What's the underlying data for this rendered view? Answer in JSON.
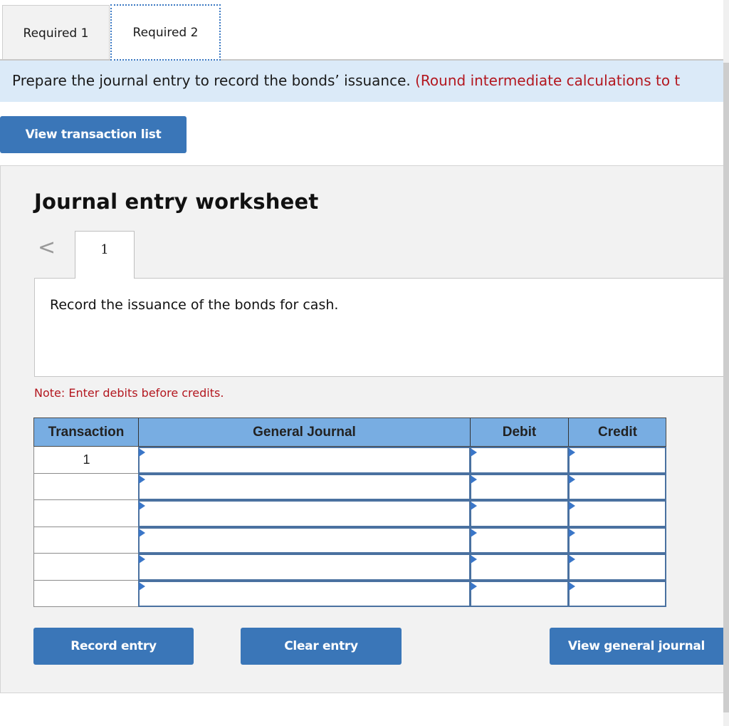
{
  "tabs": [
    {
      "label": "Required 1",
      "active": false
    },
    {
      "label": "Required 2",
      "active": true
    }
  ],
  "instruction": {
    "text": "Prepare the journal entry to record the bonds’ issuance.",
    "note": "(Round intermediate calculations to t"
  },
  "buttons": {
    "view_transaction_list": "View transaction list",
    "record_entry": "Record entry",
    "clear_entry": "Clear entry",
    "view_general_journal": "View general journal"
  },
  "worksheet": {
    "title": "Journal entry worksheet",
    "prev_icon": "chevron-left-icon",
    "prev_glyph": "<",
    "current_step": "1",
    "description": "Record the issuance of the bonds for cash.",
    "note": "Note: Enter debits before credits."
  },
  "journal_table": {
    "headers": {
      "transaction": "Transaction",
      "general_journal": "General Journal",
      "debit": "Debit",
      "credit": "Credit"
    },
    "rows": [
      {
        "transaction": "1",
        "account": "",
        "debit": "",
        "credit": ""
      },
      {
        "transaction": "",
        "account": "",
        "debit": "",
        "credit": ""
      },
      {
        "transaction": "",
        "account": "",
        "debit": "",
        "credit": ""
      },
      {
        "transaction": "",
        "account": "",
        "debit": "",
        "credit": ""
      },
      {
        "transaction": "",
        "account": "",
        "debit": "",
        "credit": ""
      },
      {
        "transaction": "",
        "account": "",
        "debit": "",
        "credit": ""
      }
    ]
  },
  "colors": {
    "button_blue": "#3a76b8",
    "header_blue": "#78ade2",
    "banner_bg": "#dbeaf8",
    "note_red": "#b3171f",
    "panel_bg": "#f2f2f2"
  }
}
